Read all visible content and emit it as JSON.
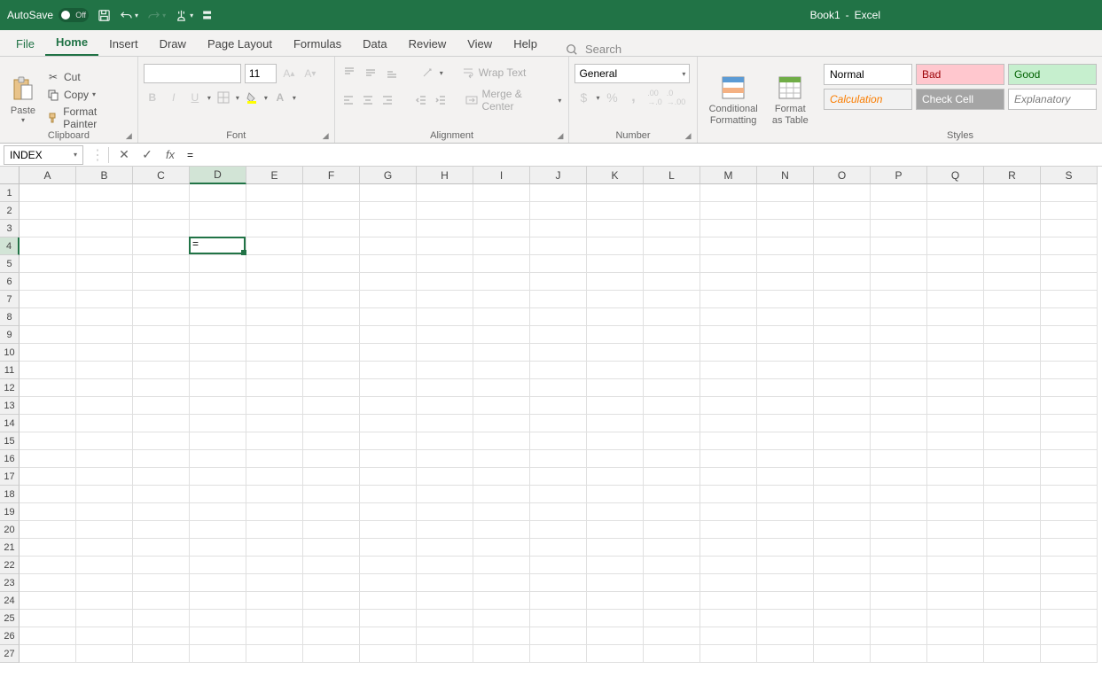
{
  "titlebar": {
    "autosave_label": "AutoSave",
    "autosave_state": "Off",
    "doc_name": "Book1",
    "app_name": "Excel",
    "separator": "-"
  },
  "tabs": {
    "file": "File",
    "home": "Home",
    "insert": "Insert",
    "draw": "Draw",
    "page_layout": "Page Layout",
    "formulas": "Formulas",
    "data": "Data",
    "review": "Review",
    "view": "View",
    "help": "Help",
    "search": "Search"
  },
  "ribbon": {
    "paste": "Paste",
    "cut": "Cut",
    "copy": "Copy",
    "format_painter": "Format Painter",
    "clipboard": "Clipboard",
    "font_name": "",
    "font_size": "11",
    "font": "Font",
    "wrap_text": "Wrap Text",
    "merge_center": "Merge & Center",
    "alignment": "Alignment",
    "number_format": "General",
    "number": "Number",
    "cond_format": "Conditional Formatting",
    "format_table": "Format as Table",
    "styles": "Styles",
    "style_normal": "Normal",
    "style_bad": "Bad",
    "style_good": "Good",
    "style_calc": "Calculation",
    "style_check": "Check Cell",
    "style_exp": "Explanatory"
  },
  "formula_bar": {
    "name_box": "INDEX",
    "formula": "="
  },
  "grid": {
    "columns": [
      "A",
      "B",
      "C",
      "D",
      "E",
      "F",
      "G",
      "H",
      "I",
      "J",
      "K",
      "L",
      "M",
      "N",
      "O",
      "P",
      "Q",
      "R",
      "S"
    ],
    "rows": [
      "1",
      "2",
      "3",
      "4",
      "5",
      "6",
      "7",
      "8",
      "9",
      "10",
      "11",
      "12",
      "13",
      "14",
      "15",
      "16",
      "17",
      "18",
      "19",
      "20",
      "21",
      "22",
      "23",
      "24",
      "25",
      "26",
      "27"
    ],
    "active_col": "D",
    "active_row": "4",
    "active_value": "="
  }
}
